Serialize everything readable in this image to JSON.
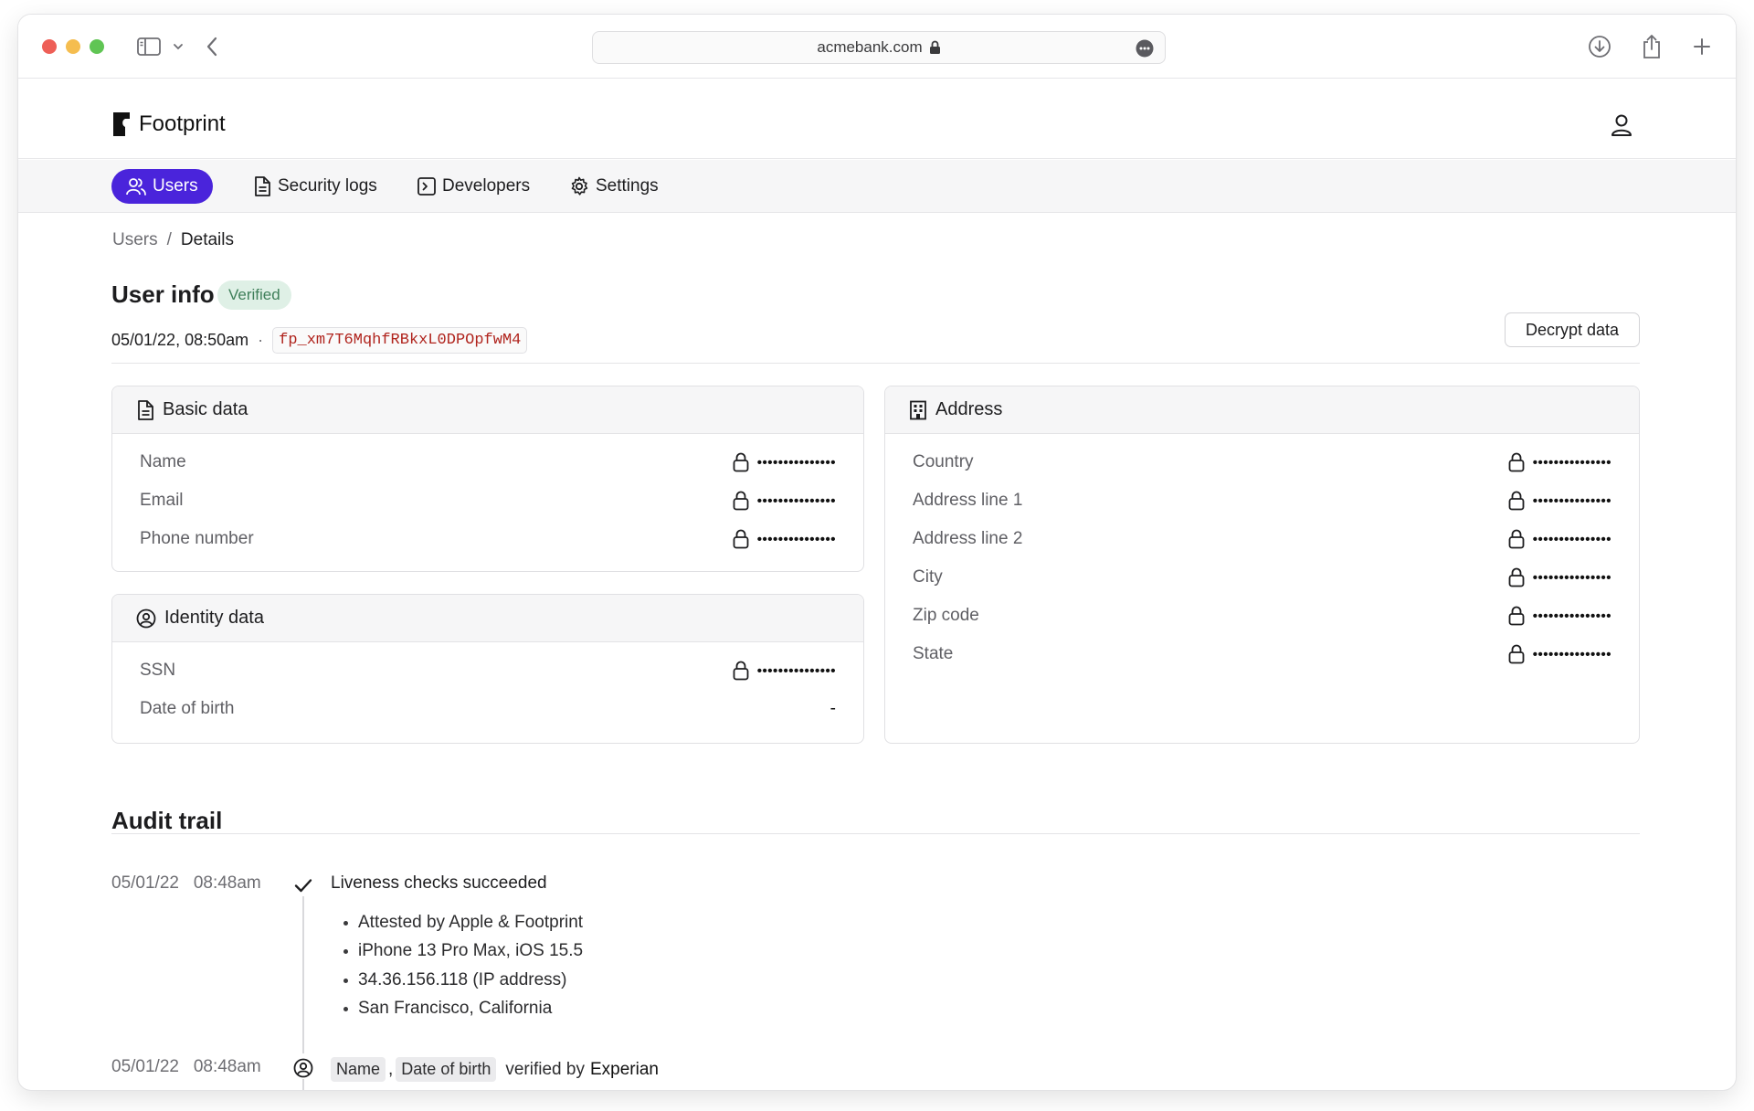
{
  "browser": {
    "url": "acmebank.com"
  },
  "app": {
    "brand": "Footprint"
  },
  "nav": {
    "items": [
      {
        "label": "Users",
        "active": true
      },
      {
        "label": "Security logs",
        "active": false
      },
      {
        "label": "Developers",
        "active": false
      },
      {
        "label": "Settings",
        "active": false
      }
    ]
  },
  "breadcrumb": {
    "parent": "Users",
    "separator": "/",
    "current": "Details"
  },
  "user": {
    "title": "User info",
    "status": "Verified",
    "timestamp": "05/01/22, 08:50am",
    "separator": "·",
    "id": "fp_xm7T6MqhfRBkxL0DPOpfwM4",
    "decrypt_label": "Decrypt data"
  },
  "basic_data": {
    "title": "Basic data",
    "rows": [
      {
        "label": "Name",
        "value": "•••••••••••••••"
      },
      {
        "label": "Email",
        "value": "•••••••••••••••"
      },
      {
        "label": "Phone number",
        "value": "•••••••••••••••"
      }
    ]
  },
  "identity_data": {
    "title": "Identity data",
    "rows": [
      {
        "label": "SSN",
        "value": "•••••••••••••••"
      },
      {
        "label": "Date of birth",
        "value": "-"
      }
    ]
  },
  "address": {
    "title": "Address",
    "rows": [
      {
        "label": "Country",
        "value": "•••••••••••••••"
      },
      {
        "label": "Address line 1",
        "value": "•••••••••••••••"
      },
      {
        "label": "Address line 2",
        "value": "•••••••••••••••"
      },
      {
        "label": "City",
        "value": "•••••••••••••••"
      },
      {
        "label": "Zip code",
        "value": "•••••••••••••••"
      },
      {
        "label": "State",
        "value": "•••••••••••••••"
      }
    ]
  },
  "audit": {
    "title": "Audit trail",
    "events": [
      {
        "date": "05/01/22",
        "time": "08:48am",
        "title": "Liveness checks succeeded",
        "details": [
          "Attested by Apple & Footprint",
          "iPhone 13 Pro Max, iOS 15.5",
          "34.36.156.118 (IP address)",
          "San Francisco, California"
        ]
      },
      {
        "date": "05/01/22",
        "time": "08:48am",
        "tags": [
          "Name",
          "Date of birth"
        ],
        "comma": ",",
        "verified_by_text": "verified by",
        "source": "Experian"
      }
    ]
  }
}
